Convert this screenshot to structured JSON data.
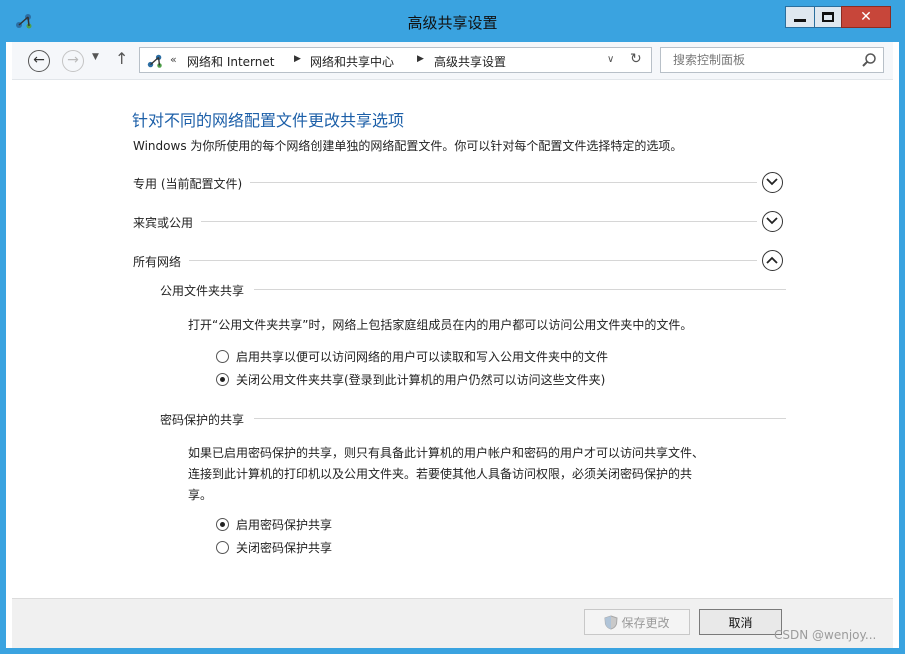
{
  "window": {
    "title": "高级共享设置",
    "close_glyph": "✕"
  },
  "nav": {
    "back_glyph": "←",
    "forward_glyph": "→",
    "dropdown_glyph": "▼",
    "up_glyph": "↑",
    "address_prefix": "«",
    "breadcrumbs": [
      "网络和 Internet",
      "网络和共享中心",
      "高级共享设置"
    ],
    "crumb_arrow": "▶",
    "address_dropdown_glyph": "∨",
    "refresh_glyph": "↻",
    "search_placeholder": "搜索控制面板"
  },
  "main": {
    "heading": "针对不同的网络配置文件更改共享选项",
    "description": "Windows 为你所使用的每个网络创建单独的网络配置文件。你可以针对每个配置文件选择特定的选项。",
    "profiles": [
      {
        "label": "专用 (当前配置文件)",
        "expanded": false
      },
      {
        "label": "来宾或公用",
        "expanded": false
      },
      {
        "label": "所有网络",
        "expanded": true
      }
    ],
    "public_folder": {
      "title": "公用文件夹共享",
      "description": "打开“公用文件夹共享”时，网络上包括家庭组成员在内的用户都可以访问公用文件夹中的文件。",
      "options": [
        {
          "label": "启用共享以便可以访问网络的用户可以读取和写入公用文件夹中的文件",
          "checked": false
        },
        {
          "label": "关闭公用文件夹共享(登录到此计算机的用户仍然可以访问这些文件夹)",
          "checked": true
        }
      ]
    },
    "password": {
      "title": "密码保护的共享",
      "description_lines": [
        "如果已启用密码保护的共享，则只有具备此计算机的用户帐户和密码的用户才可以访问共享文件、",
        "连接到此计算机的打印机以及公用文件夹。若要使其他人具备访问权限，必须关闭密码保护的共",
        "享。"
      ],
      "options": [
        {
          "label": "启用密码保护共享",
          "checked": true
        },
        {
          "label": "关闭密码保护共享",
          "checked": false
        }
      ]
    }
  },
  "footer": {
    "save_label": "保存更改",
    "cancel_label": "取消",
    "watermark": "CSDN @wenjoy..."
  },
  "colors": {
    "titlebar": "#3aa3e0",
    "heading": "#1c5fa8",
    "close_button": "#c7463a"
  }
}
